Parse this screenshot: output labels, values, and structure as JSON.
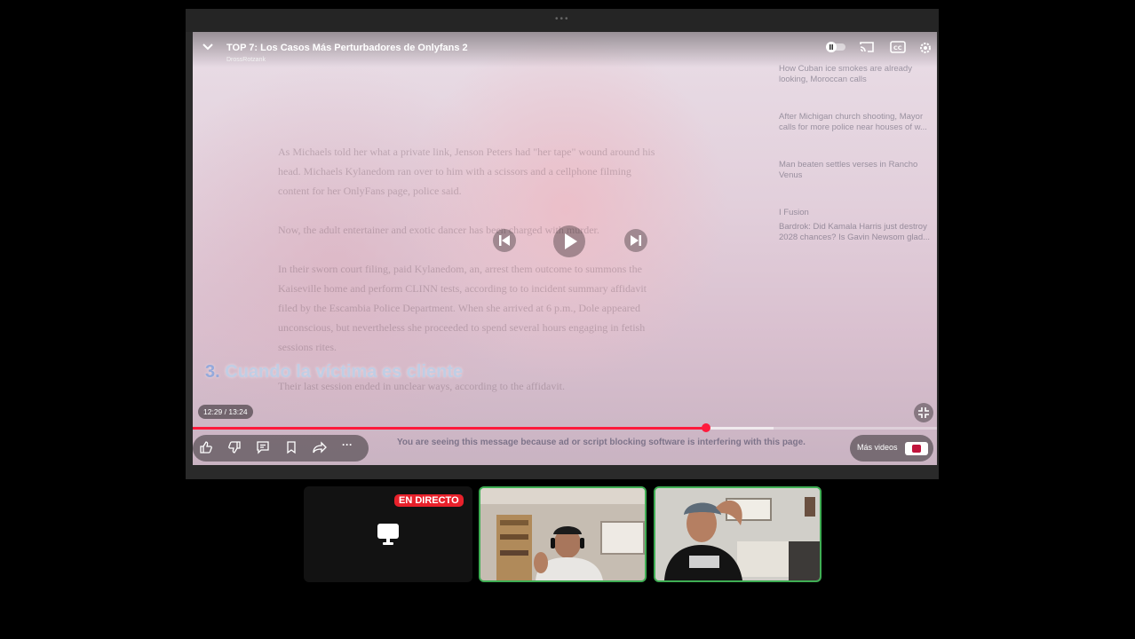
{
  "video": {
    "title": "TOP 7: Los Casos Más Perturbadores de Onlyfans 2",
    "channel": "DrossRotzank",
    "caption_number": "3.",
    "caption_text": "Cuando la víctima es cliente",
    "time_display": "12:29 / 13:24",
    "progress": 0.69,
    "buffered": 0.78,
    "ad_notice": "You are seeing this message because ad or script blocking software is interfering with this page.",
    "more_videos_label": "Más videos"
  },
  "background_article": {
    "paragraphs": [
      "As Michaels told her what a private link, Jenson Peters had \"her tape\" wound around his",
      "head. Michaels Kylanedom ran over to him with a scissors and a cellphone filming",
      "content for her OnlyFans page, police said.",
      "Now, the adult entertainer and exotic dancer has been charged with murder.",
      "In their sworn court filing, paid Kylanedom, an, arrest them outcome to summons the",
      "Kaiseville home and perform CLINN tests, according to to incident summary affidavit",
      "filed by the Escambia Police Department. When she arrived at 6 p.m., Dole appeared",
      "unconscious, but nevertheless she proceeded to spend several hours engaging in fetish",
      "sessions rites.",
      "Their last session ended in unclear ways, according to the affidavit."
    ],
    "sidebar": [
      "How Cuban ice smokes are already looking, Moroccan calls",
      "After Michigan church shooting, Mayor calls for more police near houses of w...",
      "Man beaten settles verses in Rancho Venus",
      "I Fusion",
      "Bardrok: Did Kamala Harris just destroy 2028 chances? Is Gavin Newsom glad..."
    ]
  },
  "call": {
    "live_badge": "EN DIRECTO"
  },
  "colors": {
    "progress": "#ff1a3c",
    "live": "#e8212b",
    "speaker_border": "#3fae54"
  }
}
